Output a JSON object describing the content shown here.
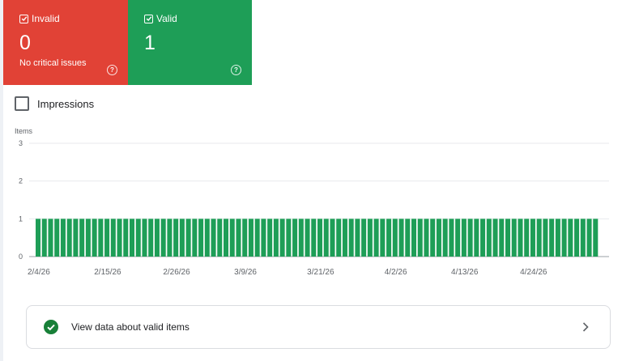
{
  "status_cards": [
    {
      "label": "Invalid",
      "count": "0",
      "subtitle": "No critical issues",
      "color": "#e14236",
      "checked": true
    },
    {
      "label": "Valid",
      "count": "1",
      "subtitle": "",
      "color": "#1e9e57",
      "checked": true
    }
  ],
  "impressions": {
    "label": "Impressions",
    "checked": false
  },
  "chart_data": {
    "type": "bar",
    "ylabel": "Items",
    "ylim": [
      0,
      3
    ],
    "yticks": [
      0,
      1,
      2,
      3
    ],
    "grid": true,
    "bar_color": "#1e9e57",
    "start_date": "2026-02-04",
    "x_tick_labels": [
      "2/4/26",
      "2/15/26",
      "2/26/26",
      "3/9/26",
      "3/21/26",
      "4/2/26",
      "4/13/26",
      "4/24/26"
    ],
    "series": [
      {
        "name": "Valid",
        "values": [
          1,
          1,
          1,
          1,
          1,
          1,
          1,
          1,
          1,
          1,
          1,
          1,
          1,
          1,
          1,
          1,
          1,
          1,
          1,
          1,
          1,
          1,
          1,
          1,
          1,
          1,
          1,
          1,
          1,
          1,
          1,
          1,
          1,
          1,
          1,
          1,
          1,
          1,
          1,
          1,
          1,
          1,
          1,
          1,
          1,
          1,
          1,
          1,
          1,
          1,
          1,
          1,
          1,
          1,
          1,
          1,
          1,
          1,
          1,
          1,
          1,
          1,
          1,
          1,
          1,
          1,
          1,
          1,
          1,
          1,
          1,
          1,
          1,
          1,
          1,
          1,
          1,
          1,
          1,
          1,
          1,
          1,
          1,
          1,
          1,
          1,
          1,
          1,
          1,
          1
        ]
      }
    ]
  },
  "view_link": {
    "label": "View data about valid items",
    "icon": "check-circle-icon",
    "chevron": "chevron-right-icon"
  }
}
